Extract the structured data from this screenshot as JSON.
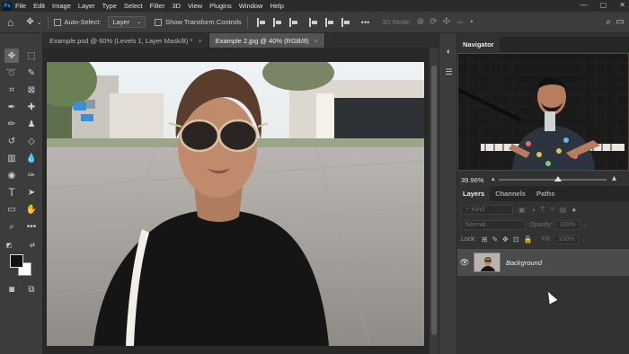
{
  "menubar": {
    "logo": "Ps",
    "items": [
      "File",
      "Edit",
      "Image",
      "Layer",
      "Type",
      "Select",
      "Filter",
      "3D",
      "View",
      "Plugins",
      "Window",
      "Help"
    ],
    "window_controls": [
      "—",
      "▢",
      "✕"
    ]
  },
  "options": {
    "auto_select_label": "Auto-Select:",
    "auto_select_value": "Layer",
    "transform_label": "Show Transform Controls",
    "mode_label": "3D Mode:"
  },
  "tabs": [
    {
      "label": "Example.psd @ 60% (Levels 1, Layer Mask/8) *",
      "close": "×"
    },
    {
      "label": "Example 2.jpg @ 40% (RGB/8)",
      "close": "×"
    }
  ],
  "navigator": {
    "tab_label": "Navigator",
    "zoom_value": "39.96%",
    "zoom_fraction": 0.55
  },
  "layers_panel": {
    "tabs": [
      "Layers",
      "Channels",
      "Paths"
    ],
    "kind_label": "Kind",
    "blend_mode": "Normal",
    "opacity_label": "Opacity:",
    "opacity_value": "100%",
    "lock_label": "Lock:",
    "fill_label": "Fill:",
    "fill_value": "100%",
    "layers": [
      {
        "name": "Background",
        "visible": true
      }
    ]
  },
  "colors": {
    "accent": "#31a8ff",
    "foreground": "#111111",
    "background": "#ffffff"
  }
}
